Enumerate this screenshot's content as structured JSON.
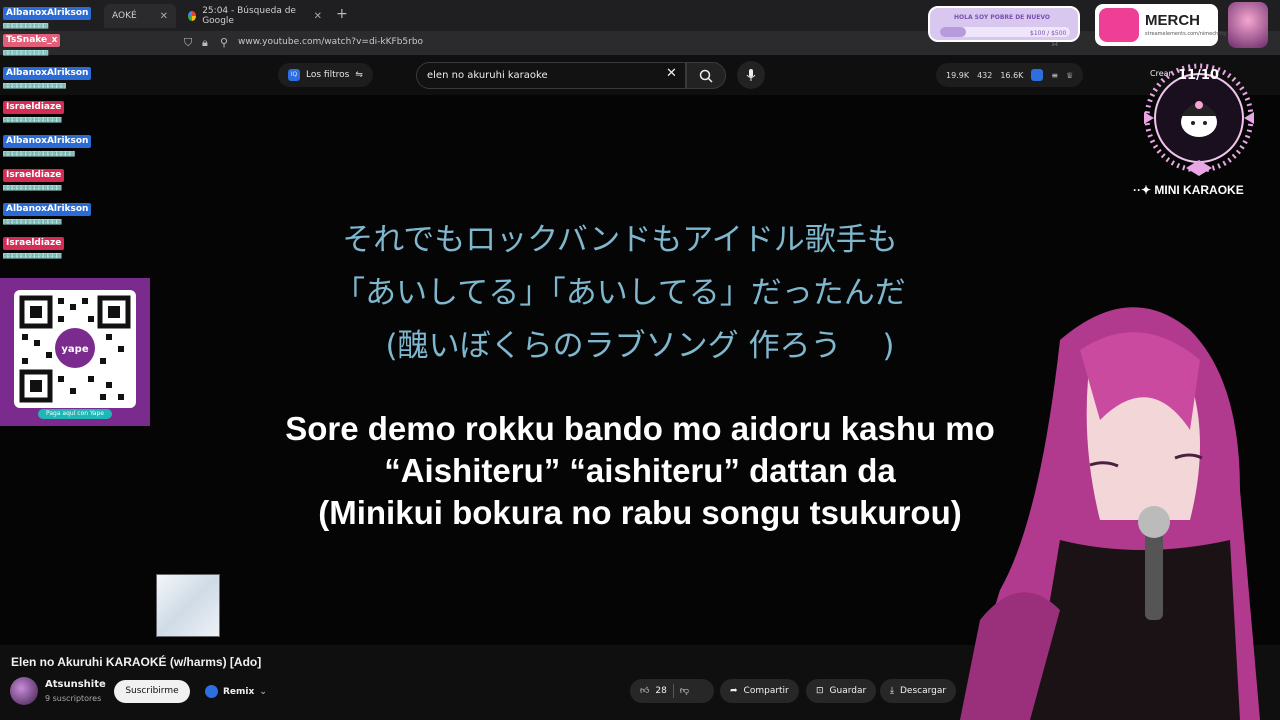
{
  "browser": {
    "tabs": [
      {
        "label": "AOKÉ",
        "active": true
      },
      {
        "label": "25:04 - Búsqueda de Google",
        "active": false
      }
    ],
    "url": "www.youtube.com/watch?v=di-kKFb5rbo"
  },
  "youtube": {
    "filters_label": "Los filtros",
    "search_value": "elen no akuruhi karaoke",
    "stats": [
      "19.9K",
      "432",
      "16.6K"
    ],
    "create_label": "Crear"
  },
  "chat": [
    {
      "user": "AlbanoxAlrikson",
      "color": "blue"
    },
    {
      "user": "TsSnake_x",
      "color": "pink"
    },
    {
      "user": "AlbanoxAlrikson",
      "color": "blue"
    },
    {
      "user": "Israeldiaze",
      "color": "red"
    },
    {
      "user": "AlbanoxAlrikson",
      "color": "blue"
    },
    {
      "user": "Israeldiaze",
      "color": "red"
    },
    {
      "user": "AlbanoxAlrikson",
      "color": "blue"
    },
    {
      "user": "Israeldiaze",
      "color": "red"
    }
  ],
  "qr": {
    "label": "Paga aquí con Yape",
    "brand": "yape"
  },
  "lyrics": {
    "japanese": [
      "それでもロックバンドもアイドル歌手も",
      "「あいしてる」「あいしてる」だったんだ",
      "(醜いぼくらのラブソング 作ろう　 )"
    ],
    "romaji": [
      "Sore demo rokku bando mo aidoru kashu mo",
      "“Aishiteru” “aishiteru” dattan da",
      "(Minikui bokura no rabu songu tsukurou)"
    ]
  },
  "video": {
    "title": "Elen no Akuruhi KARAOKÉ (w/harms) [Ado]",
    "channel": "Atsunshite",
    "subscribers": "9 suscriptores",
    "subscribe_label": "Suscribirme",
    "remix_label": "Remix",
    "likes": "28",
    "share_label": "Compartir",
    "save_label": "Guardar",
    "download_label": "Descargar"
  },
  "overlay": {
    "goal_title": "HOLA SOY POBRE DE NUEVO",
    "goal_amount": "$100 / $500",
    "goal_fraction": 0.2,
    "merch_label": "MERCH",
    "merch_sub": "streamelements.com/nimechitty",
    "counter": "11/10",
    "mini_karaoke": "··✦ MINI KARAOKE"
  }
}
